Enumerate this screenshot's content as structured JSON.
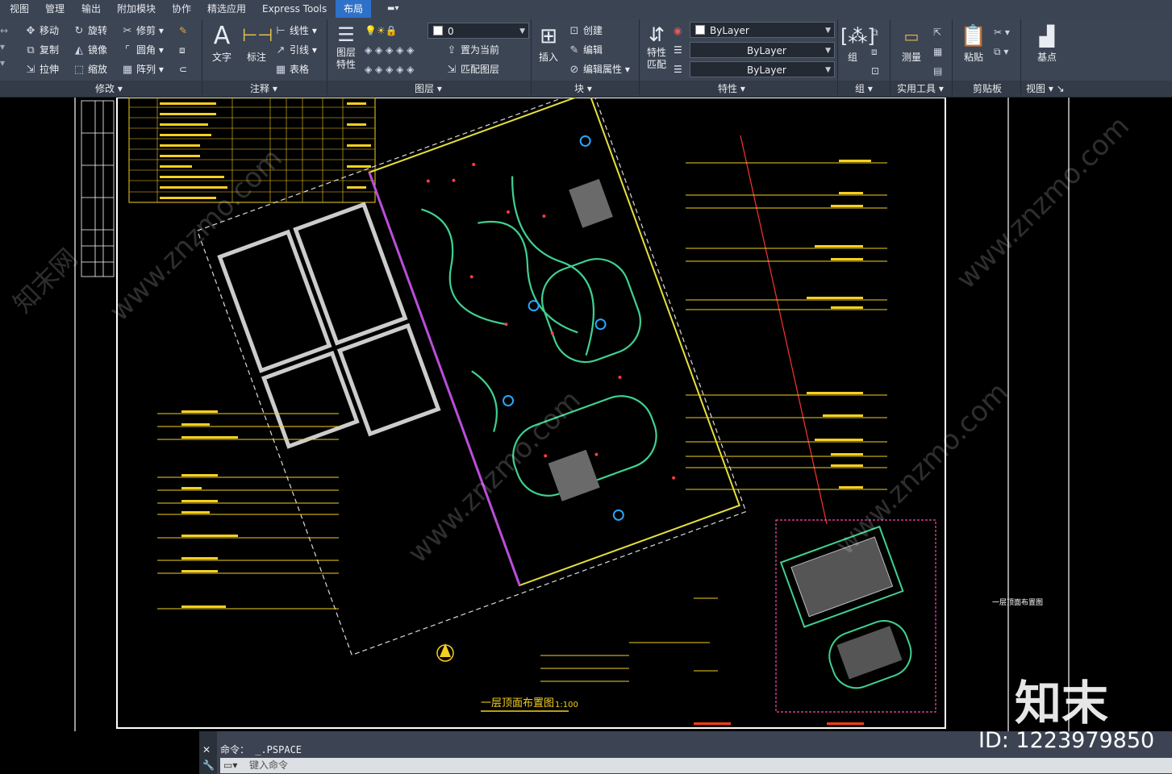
{
  "menu_tabs": [
    "视图",
    "管理",
    "输出",
    "附加模块",
    "协作",
    "精选应用",
    "Express Tools",
    "布局"
  ],
  "active_tab": "布局",
  "panels": {
    "modify": {
      "label": "修改",
      "tools": [
        "移动",
        "旋转",
        "修剪",
        "复制",
        "镜像",
        "圆角",
        "拉伸",
        "缩放",
        "阵列"
      ]
    },
    "annotation": {
      "label": "注释",
      "text": "文字",
      "dim": "标注",
      "linetype": "线性",
      "leader": "引线",
      "table": "表格"
    },
    "layers": {
      "label": "图层",
      "props": "图层\n特性",
      "layer_value": "0",
      "set_current": "置为当前",
      "match_layer": "匹配图层"
    },
    "block": {
      "label": "块",
      "insert": "插入",
      "create": "创建",
      "edit": "编辑",
      "edit_attr": "编辑属性"
    },
    "properties": {
      "label": "特性",
      "match": "特性\n匹配",
      "color": "ByLayer",
      "linetype": "ByLayer",
      "lineweight": "ByLayer"
    },
    "groups": {
      "label": "组",
      "group": "组"
    },
    "utilities": {
      "label": "实用工具",
      "measure": "测量"
    },
    "clipboard": {
      "label": "剪贴板",
      "paste": "粘贴"
    },
    "view": {
      "label": "视图",
      "basepoint": "基点"
    }
  },
  "drawing": {
    "title": "一层顶面布置图",
    "scale": "1:100",
    "side_title": "一层顶面布置图",
    "watermark_site": "www.znzmo.com",
    "watermark_cn": "知末网"
  },
  "command": {
    "history": "命令： _.PSPACE",
    "placeholder": "键入命令"
  },
  "watermark": {
    "brand": "知末",
    "id": "ID: 1223979850"
  }
}
